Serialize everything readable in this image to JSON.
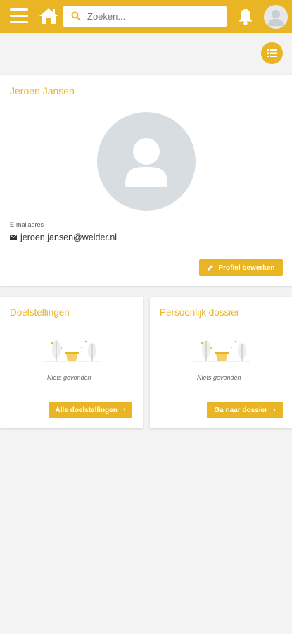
{
  "header": {
    "search_placeholder": "Zoeken...",
    "colors": {
      "brand": "#e9b525",
      "background": "#f3f3f3"
    }
  },
  "profile": {
    "name": "Jeroen Jansen",
    "email_label": "E-mailadres",
    "email": "jeroen.jansen@welder.nl",
    "edit_label": "Profiel bewerken"
  },
  "goals": {
    "title": "Doelstellingen",
    "empty_text": "Niets gevonden",
    "button_label": "Alle doelstellingen"
  },
  "dossier": {
    "title": "Persoonlijk dossier",
    "empty_text": "Niets gevonden",
    "button_label": "Ga naar dossier"
  }
}
